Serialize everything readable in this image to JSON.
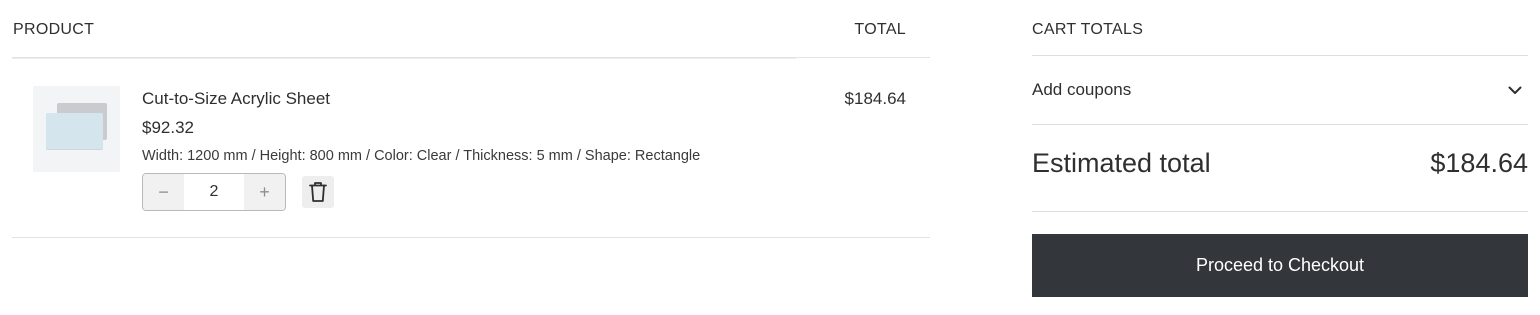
{
  "table": {
    "header_product": "PRODUCT",
    "header_total": "TOTAL"
  },
  "item": {
    "name": "Cut-to-Size Acrylic Sheet",
    "price": "$92.32",
    "attributes": "Width: 1200 mm / Height: 800 mm / Color: Clear / Thickness: 5 mm / Shape: Rectangle",
    "quantity": "2",
    "decrease_symbol": "−",
    "increase_symbol": "+",
    "line_total": "$184.64",
    "thumbnail_icon": "acrylic-sheet-thumbnail",
    "remove_icon": "trash-icon"
  },
  "totals": {
    "title": "CART TOTALS",
    "coupons_label": "Add coupons",
    "coupons_icon": "chevron-down-icon",
    "estimated_label": "Estimated total",
    "estimated_value": "$184.64",
    "checkout_label": "Proceed to Checkout"
  },
  "colors": {
    "checkout_bg": "#33363a",
    "text": "#2f2f2f",
    "divider": "#dedede"
  }
}
